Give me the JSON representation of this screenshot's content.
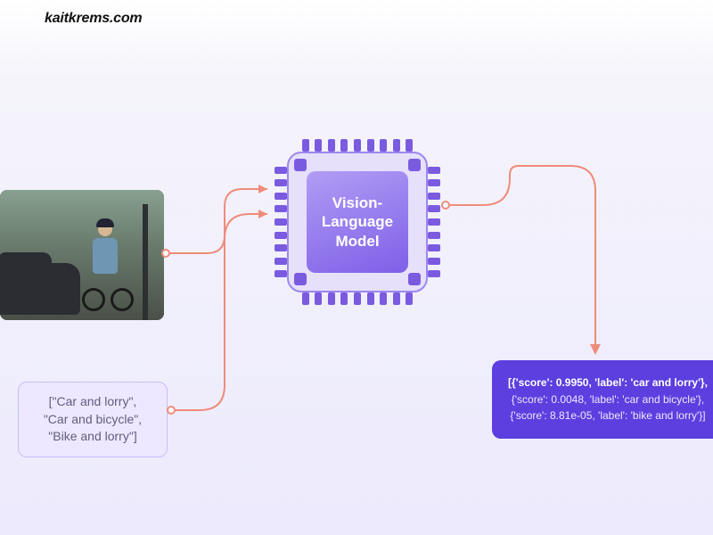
{
  "watermark": "kaitkrems.com",
  "model": {
    "title": "Vision-\nLanguage\nModel"
  },
  "input_labels": {
    "line1": "[\"Car and lorry\",",
    "line2": "\"Car and bicycle\",",
    "line3": "\"Bike and lorry\"]"
  },
  "output": {
    "line1": "[{'score': 0.9950, 'label': 'car and lorry'},",
    "line2": "{'score': 0.0048, 'label': 'car and bicycle'},",
    "line3": "{'score': 8.81e-05, 'label': 'bike and lorry'}]"
  },
  "image_alt": "cyclist-street-photo"
}
